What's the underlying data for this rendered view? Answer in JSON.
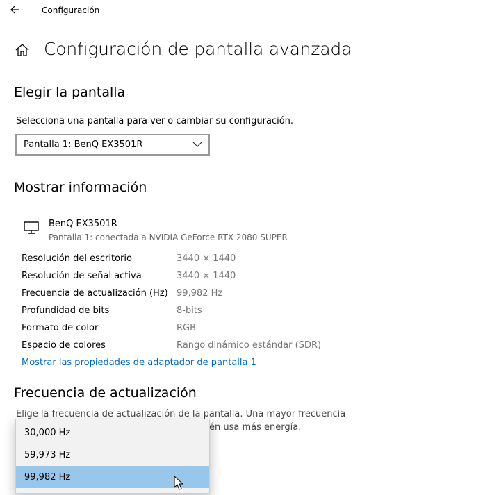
{
  "window": {
    "title": "Configuración"
  },
  "page": {
    "title": "Configuración de pantalla avanzada"
  },
  "choose_display": {
    "heading": "Elegir la pantalla",
    "description": "Selecciona una pantalla para ver o cambiar su configuración.",
    "selected": "Pantalla 1: BenQ EX3501R"
  },
  "display_info": {
    "heading": "Mostrar información",
    "monitor_name": "BenQ EX3501R",
    "monitor_subtitle": "Pantalla 1: conectada a NVIDIA GeForce RTX 2080 SUPER",
    "rows": [
      {
        "label": "Resolución del escritorio",
        "value": "3440 × 1440"
      },
      {
        "label": "Resolución de señal activa",
        "value": "3440 × 1440"
      },
      {
        "label": "Frecuencia de actualización (Hz)",
        "value": "99,982 Hz"
      },
      {
        "label": "Profundidad de bits",
        "value": "8-bits"
      },
      {
        "label": "Formato de color",
        "value": "RGB"
      },
      {
        "label": "Espacio de colores",
        "value": "Rango dinámico estándar (SDR)"
      }
    ],
    "adapter_link": "Mostrar las propiedades de adaptador de pantalla 1"
  },
  "refresh_rate": {
    "heading": "Frecuencia de actualización",
    "description_line1": "Elige la frecuencia de actualización de la pantalla. Una mayor frecuencia",
    "description_line2": "én usa más energía.",
    "options": [
      "30,000 Hz",
      "59,973 Hz",
      "99,982 Hz"
    ],
    "selected_index": 2
  },
  "colors": {
    "accent": "#0067b8",
    "selected_option": "#99c7ec"
  }
}
